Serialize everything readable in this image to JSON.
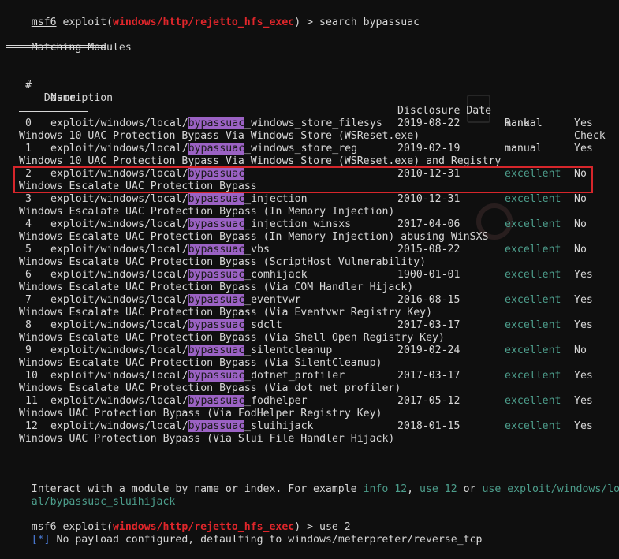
{
  "prompt": {
    "prefix": "msf6",
    "module": "windows/http/rejetto_hfs_exec"
  },
  "command1": "search bypassuac",
  "heading": "Matching Modules",
  "columns": {
    "num": "#",
    "name": "Name",
    "date": "Disclosure Date",
    "rank": "Rank",
    "check": "Check",
    "desc": "Description"
  },
  "search_term": "bypassuac",
  "path_prefix": "exploit/windows/local/",
  "rows": [
    {
      "num": "0",
      "prefix": "exploit/windows/local/",
      "term": "bypassuac",
      "suffix": "_windows_store_filesys",
      "date": "2019-08-22",
      "rank": "manual",
      "check": "Yes",
      "desc": "Windows 10 UAC Protection Bypass Via Windows Store (WSReset.exe)"
    },
    {
      "num": "1",
      "prefix": "exploit/windows/local/",
      "term": "bypassuac",
      "suffix": "_windows_store_reg",
      "date": "2019-02-19",
      "rank": "manual",
      "check": "Yes",
      "desc": "Windows 10 UAC Protection Bypass Via Windows Store (WSReset.exe) and Registry"
    },
    {
      "num": "2",
      "prefix": "exploit/windows/local/",
      "term": "bypassuac",
      "suffix": "",
      "date": "2010-12-31",
      "rank": "excellent",
      "check": "No",
      "desc": "Windows Escalate UAC Protection Bypass"
    },
    {
      "num": "3",
      "prefix": "exploit/windows/local/",
      "term": "bypassuac",
      "suffix": "_injection",
      "date": "2010-12-31",
      "rank": "excellent",
      "check": "No",
      "desc": "Windows Escalate UAC Protection Bypass (In Memory Injection)"
    },
    {
      "num": "4",
      "prefix": "exploit/windows/local/",
      "term": "bypassuac",
      "suffix": "_injection_winsxs",
      "date": "2017-04-06",
      "rank": "excellent",
      "check": "No",
      "desc": "Windows Escalate UAC Protection Bypass (In Memory Injection) abusing WinSXS"
    },
    {
      "num": "5",
      "prefix": "exploit/windows/local/",
      "term": "bypassuac",
      "suffix": "_vbs",
      "date": "2015-08-22",
      "rank": "excellent",
      "check": "No",
      "desc": "Windows Escalate UAC Protection Bypass (ScriptHost Vulnerability)"
    },
    {
      "num": "6",
      "prefix": "exploit/windows/local/",
      "term": "bypassuac",
      "suffix": "_comhijack",
      "date": "1900-01-01",
      "rank": "excellent",
      "check": "Yes",
      "desc": "Windows Escalate UAC Protection Bypass (Via COM Handler Hijack)"
    },
    {
      "num": "7",
      "prefix": "exploit/windows/local/",
      "term": "bypassuac",
      "suffix": "_eventvwr",
      "date": "2016-08-15",
      "rank": "excellent",
      "check": "Yes",
      "desc": "Windows Escalate UAC Protection Bypass (Via Eventvwr Registry Key)"
    },
    {
      "num": "8",
      "prefix": "exploit/windows/local/",
      "term": "bypassuac",
      "suffix": "_sdclt",
      "date": "2017-03-17",
      "rank": "excellent",
      "check": "Yes",
      "desc": "Windows Escalate UAC Protection Bypass (Via Shell Open Registry Key)"
    },
    {
      "num": "9",
      "prefix": "exploit/windows/local/",
      "term": "bypassuac",
      "suffix": "_silentcleanup",
      "date": "2019-02-24",
      "rank": "excellent",
      "check": "No",
      "desc": "Windows Escalate UAC Protection Bypass (Via SilentCleanup)"
    },
    {
      "num": "10",
      "prefix": "exploit/windows/local/",
      "term": "bypassuac",
      "suffix": "_dotnet_profiler",
      "date": "2017-03-17",
      "rank": "excellent",
      "check": "Yes",
      "desc": "Windows Escalate UAC Protection Bypass (Via dot net profiler)"
    },
    {
      "num": "11",
      "prefix": "exploit/windows/local/",
      "term": "bypassuac",
      "suffix": "_fodhelper",
      "date": "2017-05-12",
      "rank": "excellent",
      "check": "Yes",
      "desc": "Windows UAC Protection Bypass (Via FodHelper Registry Key)"
    },
    {
      "num": "12",
      "prefix": "exploit/windows/local/",
      "term": "bypassuac",
      "suffix": "_sluihijack",
      "date": "2018-01-15",
      "rank": "excellent",
      "check": "Yes",
      "desc": "Windows UAC Protection Bypass (Via Slui File Handler Hijack)"
    }
  ],
  "selected_row": "2",
  "interact": {
    "pre": "Interact with a module by name or index. For example ",
    "info": "info 12",
    "sep1": ", ",
    "use": "use 12",
    "sep2": " or ",
    "use_path_line1": "use exploit/windows/loc",
    "use_path_line2": "al/bypassuac_sluihijack"
  },
  "command2": "use 2",
  "status": {
    "marker": "[*]",
    "text": " No payload configured, defaulting to windows/meterpreter/reverse_tcp"
  },
  "colors": {
    "background": "#0f0f0f",
    "text": "#d7d7d7",
    "prompt_module": "#e0262b",
    "highlight": "#9b62c4",
    "rank_excellent": "#4d9e8c",
    "status_marker": "#4a7bd6",
    "selection_box": "#d6262b"
  }
}
